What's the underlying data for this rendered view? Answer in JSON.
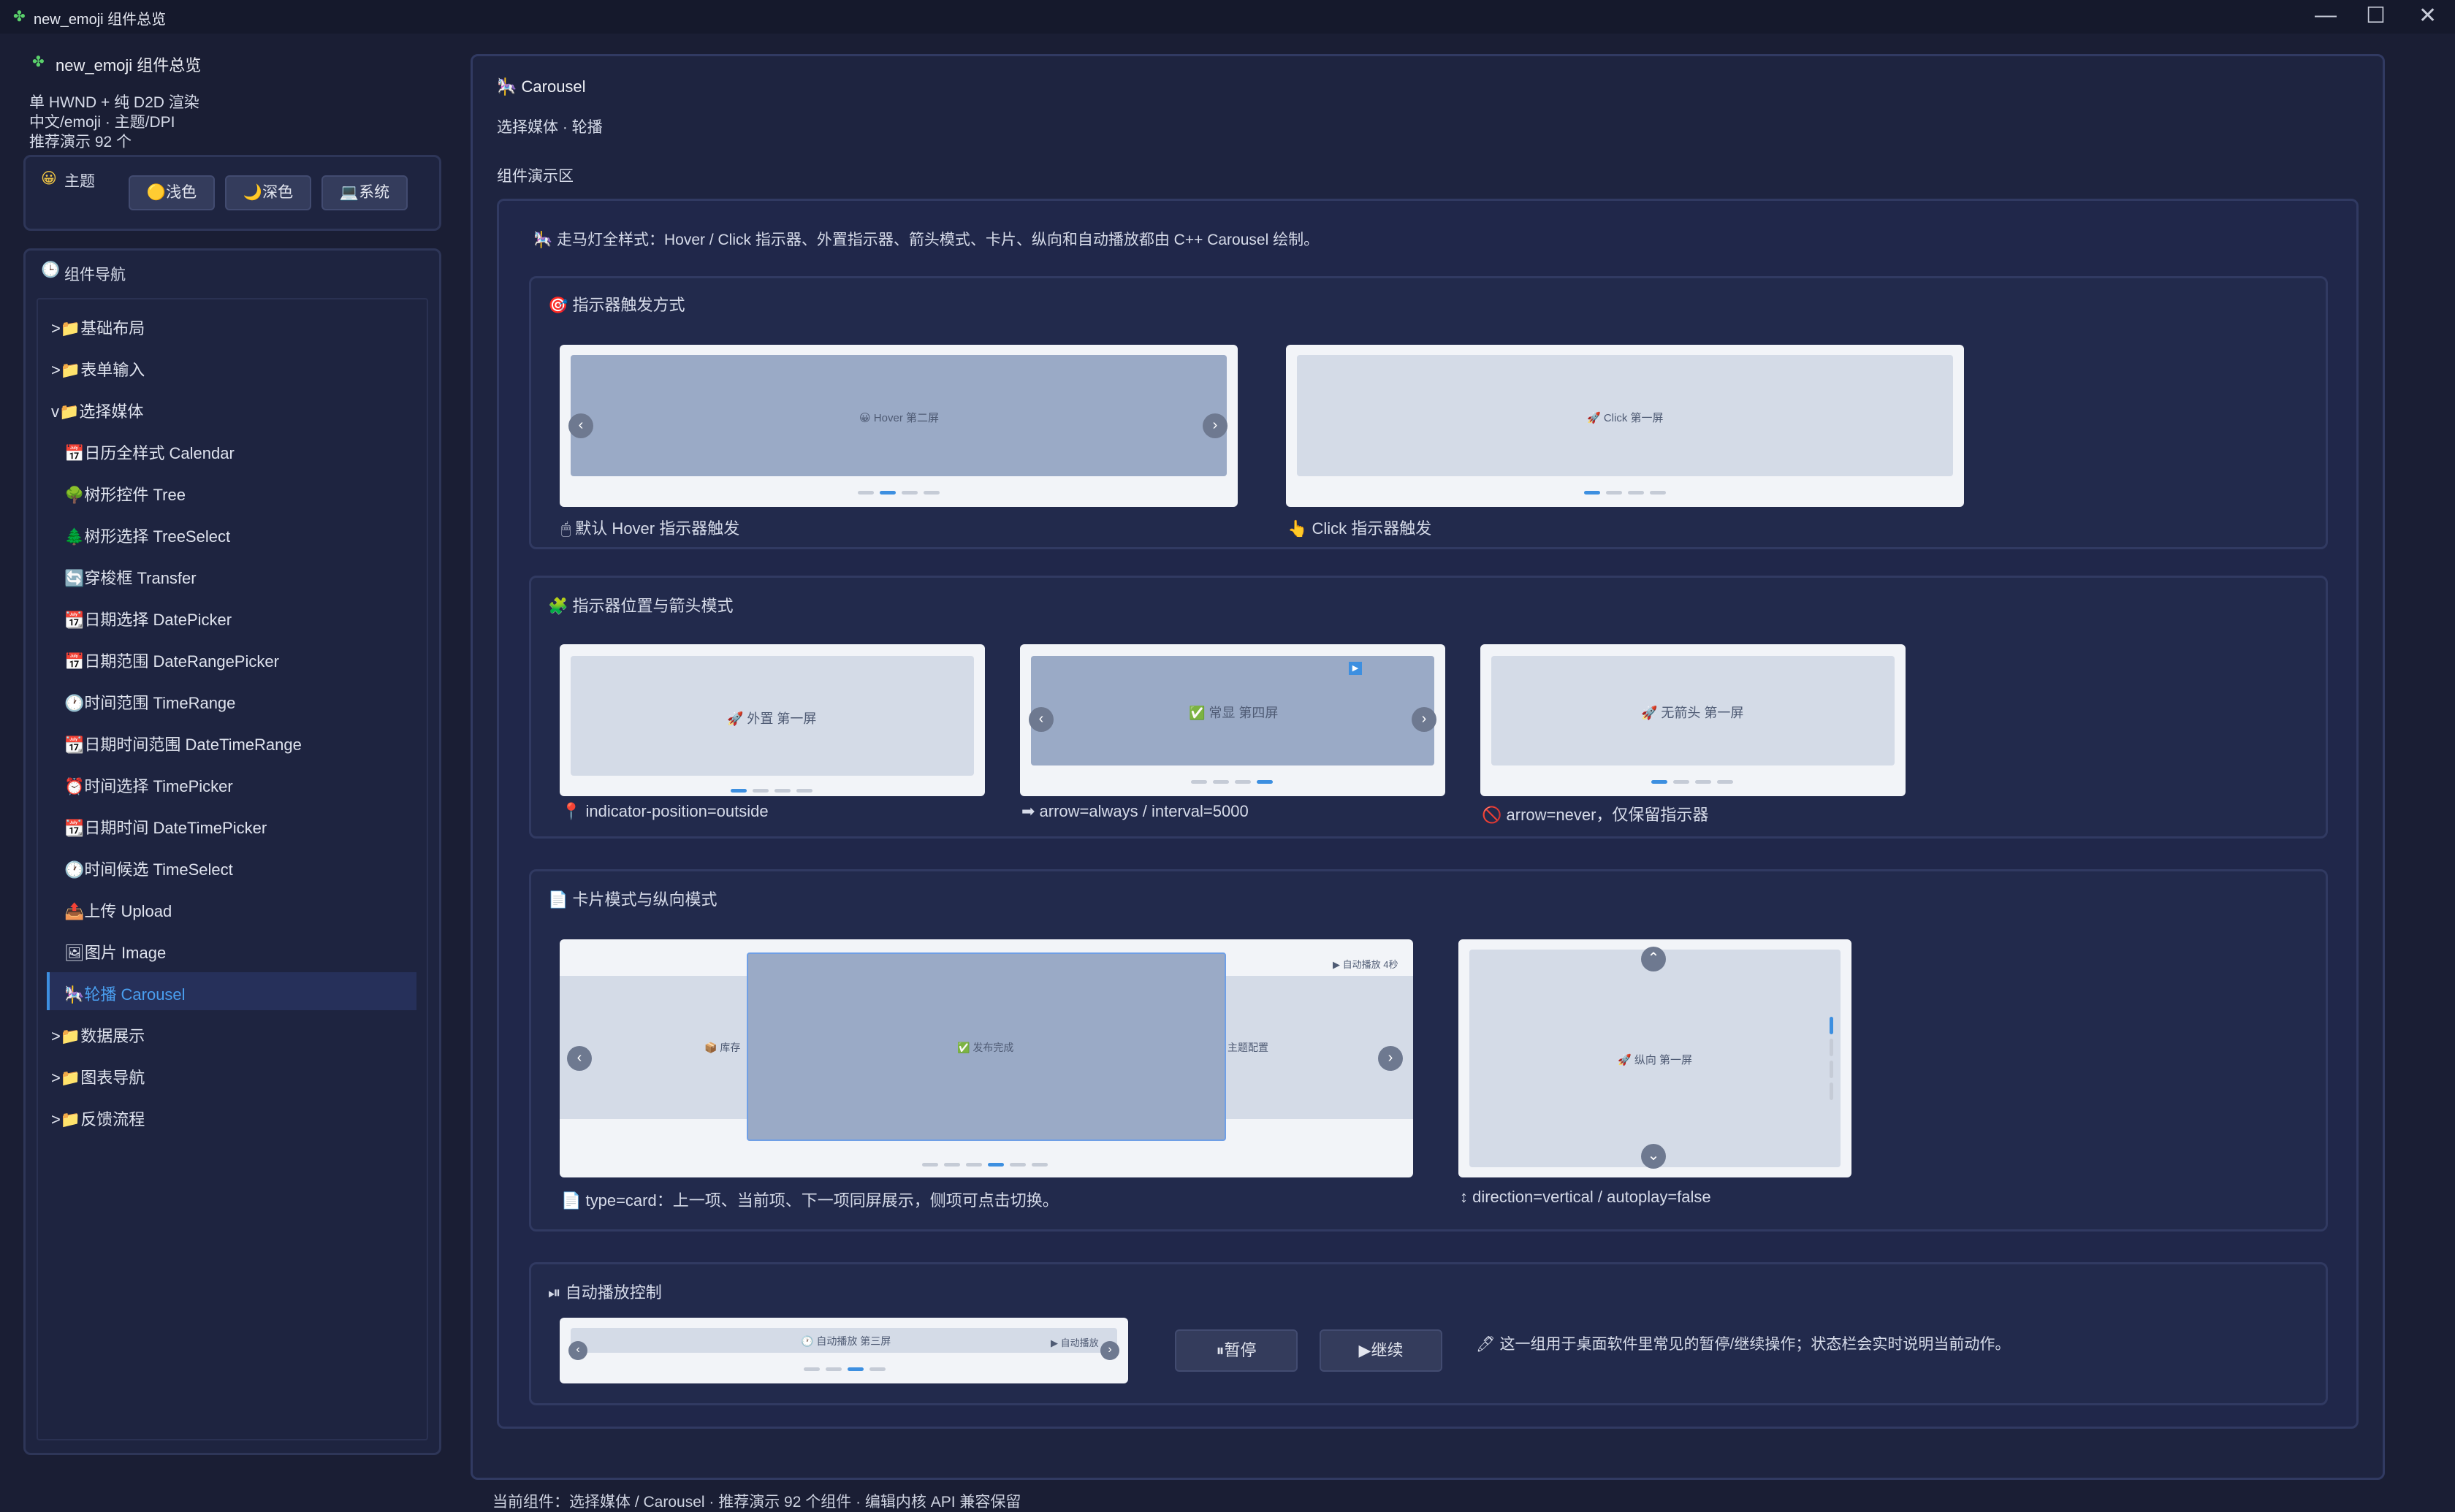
{
  "window": {
    "title": "new_emoji 组件总览",
    "title_icon": "puzzle-icon",
    "minimize_glyph": "—",
    "maximize_glyph": "☐",
    "close_glyph": "✕"
  },
  "app_info": {
    "name": "new_emoji 组件总览",
    "line1": "单 HWND + 纯 D2D 渲染",
    "line2": "中文/emoji · 主题/DPI",
    "line3": "推荐演示 92 个"
  },
  "theme": {
    "label": "主题",
    "light": "🟡浅色",
    "dark": "🌙深色",
    "system": "💻系统"
  },
  "nav": {
    "title": "组件导航",
    "items": [
      {
        "text": ">📁基础布局"
      },
      {
        "text": ">📁表单输入"
      },
      {
        "text": "v📁选择媒体"
      },
      {
        "text": "📅日历全样式 Calendar"
      },
      {
        "text": "🌳树形控件 Tree"
      },
      {
        "text": "🌲树形选择 TreeSelect"
      },
      {
        "text": "🔄穿梭框 Transfer"
      },
      {
        "text": "📆日期选择 DatePicker"
      },
      {
        "text": "📅日期范围 DateRangePicker"
      },
      {
        "text": "🕐时间范围 TimeRange"
      },
      {
        "text": "📆日期时间范围 DateTimeRange"
      },
      {
        "text": "⏰时间选择 TimePicker"
      },
      {
        "text": "📆日期时间 DateTimePicker"
      },
      {
        "text": "🕐时间候选 TimeSelect"
      },
      {
        "text": "📤上传 Upload"
      },
      {
        "text": "🖼图片 Image"
      },
      {
        "text": "🎠轮播 Carousel"
      },
      {
        "text": ">📁数据展示"
      },
      {
        "text": ">📁图表导航"
      },
      {
        "text": ">📁反馈流程"
      }
    ]
  },
  "main": {
    "title": "🎠 Carousel",
    "subtitle": "选择媒体 · 轮播",
    "section_label": "组件演示区",
    "intro": "🎠 走马灯全样式：Hover / Click 指示器、外置指示器、箭头模式、卡片、纵向和自动播放都由 C++ Carousel 绘制。",
    "group1": {
      "title": "🎯 指示器触发方式",
      "hover_slide": "😀 Hover 第二屏",
      "click_slide": "🚀 Click 第一屏",
      "hover_caption": "🖱 默认 Hover 指示器触发",
      "click_caption": "👆 Click 指示器触发"
    },
    "group2": {
      "title": "🧩 指示器位置与箭头模式",
      "outside_slide": "🚀 外置 第一屏",
      "always_slide": "✅ 常显 第四屏",
      "never_slide": "🚀 无箭头 第一屏",
      "outside_caption": "📍 indicator-position=outside",
      "always_caption": "➡ arrow=always / interval=5000",
      "never_caption": "🚫 arrow=never，仅保留指示器",
      "always_badge": "▶"
    },
    "group3": {
      "title": "📄 卡片模式与纵向模式",
      "card_prev": "📦 库存",
      "card_current": "✅ 发布完成",
      "card_next": "主题配置",
      "card_badge": "▶ 自动播放 4秒",
      "vertical_slide": "🚀 纵向 第一屏",
      "card_caption": "📄 type=card：上一项、当前项、下一项同屏展示，侧项可点击切换。",
      "vertical_caption": "↕ direction=vertical / autoplay=false"
    },
    "group4": {
      "title": "⏯ 自动播放控制",
      "slide": "🕐 自动播放 第三屏",
      "badge": "▶ 自动播放",
      "pause_button": "⏸暂停",
      "resume_button": "▶继续",
      "note": "🖊 这一组用于桌面软件里常见的暂停/继续操作；状态栏会实时说明当前动作。"
    }
  },
  "status_bar": "当前组件：选择媒体 / Carousel · 推荐演示 92 个组件 · 编辑内核 API 兼容保留"
}
